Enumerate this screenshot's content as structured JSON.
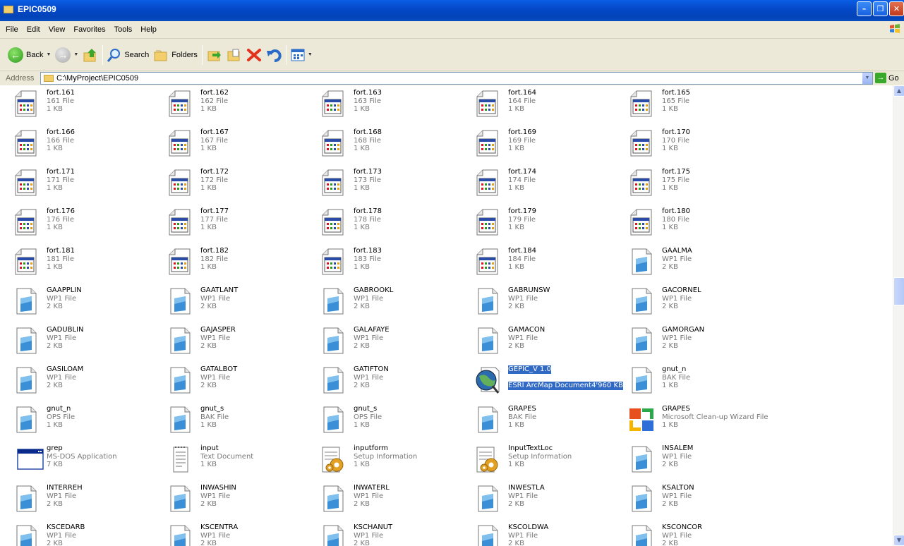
{
  "window": {
    "title": "EPIC0509"
  },
  "menu": [
    "File",
    "Edit",
    "View",
    "Favorites",
    "Tools",
    "Help"
  ],
  "toolbar": {
    "back": "Back",
    "search": "Search",
    "folders": "Folders"
  },
  "address": {
    "label": "Address",
    "path": "C:\\MyProject\\EPIC0509",
    "go": "Go"
  },
  "files": [
    {
      "name": "fort.161",
      "type": "161 File",
      "size": "1 KB",
      "icon": "data-file"
    },
    {
      "name": "fort.162",
      "type": "162 File",
      "size": "1 KB",
      "icon": "data-file"
    },
    {
      "name": "fort.163",
      "type": "163 File",
      "size": "1 KB",
      "icon": "data-file"
    },
    {
      "name": "fort.164",
      "type": "164 File",
      "size": "1 KB",
      "icon": "data-file"
    },
    {
      "name": "fort.165",
      "type": "165 File",
      "size": "1 KB",
      "icon": "data-file"
    },
    {
      "name": "fort.166",
      "type": "166 File",
      "size": "1 KB",
      "icon": "data-file"
    },
    {
      "name": "fort.167",
      "type": "167 File",
      "size": "1 KB",
      "icon": "data-file"
    },
    {
      "name": "fort.168",
      "type": "168 File",
      "size": "1 KB",
      "icon": "data-file"
    },
    {
      "name": "fort.169",
      "type": "169 File",
      "size": "1 KB",
      "icon": "data-file"
    },
    {
      "name": "fort.170",
      "type": "170 File",
      "size": "1 KB",
      "icon": "data-file"
    },
    {
      "name": "fort.171",
      "type": "171 File",
      "size": "1 KB",
      "icon": "data-file"
    },
    {
      "name": "fort.172",
      "type": "172 File",
      "size": "1 KB",
      "icon": "data-file"
    },
    {
      "name": "fort.173",
      "type": "173 File",
      "size": "1 KB",
      "icon": "data-file"
    },
    {
      "name": "fort.174",
      "type": "174 File",
      "size": "1 KB",
      "icon": "data-file"
    },
    {
      "name": "fort.175",
      "type": "175 File",
      "size": "1 KB",
      "icon": "data-file"
    },
    {
      "name": "fort.176",
      "type": "176 File",
      "size": "1 KB",
      "icon": "data-file"
    },
    {
      "name": "fort.177",
      "type": "177 File",
      "size": "1 KB",
      "icon": "data-file"
    },
    {
      "name": "fort.178",
      "type": "178 File",
      "size": "1 KB",
      "icon": "data-file"
    },
    {
      "name": "fort.179",
      "type": "179 File",
      "size": "1 KB",
      "icon": "data-file"
    },
    {
      "name": "fort.180",
      "type": "180 File",
      "size": "1 KB",
      "icon": "data-file"
    },
    {
      "name": "fort.181",
      "type": "181 File",
      "size": "1 KB",
      "icon": "data-file"
    },
    {
      "name": "fort.182",
      "type": "182 File",
      "size": "1 KB",
      "icon": "data-file"
    },
    {
      "name": "fort.183",
      "type": "183 File",
      "size": "1 KB",
      "icon": "data-file"
    },
    {
      "name": "fort.184",
      "type": "184 File",
      "size": "1 KB",
      "icon": "data-file"
    },
    {
      "name": "GAALMA",
      "type": "WP1 File",
      "size": "2 KB",
      "icon": "generic-file"
    },
    {
      "name": "GAAPPLIN",
      "type": "WP1 File",
      "size": "2 KB",
      "icon": "generic-file"
    },
    {
      "name": "GAATLANT",
      "type": "WP1 File",
      "size": "2 KB",
      "icon": "generic-file"
    },
    {
      "name": "GABROOKL",
      "type": "WP1 File",
      "size": "2 KB",
      "icon": "generic-file"
    },
    {
      "name": "GABRUNSW",
      "type": "WP1 File",
      "size": "2 KB",
      "icon": "generic-file"
    },
    {
      "name": "GACORNEL",
      "type": "WP1 File",
      "size": "2 KB",
      "icon": "generic-file"
    },
    {
      "name": "GADUBLIN",
      "type": "WP1 File",
      "size": "2 KB",
      "icon": "generic-file"
    },
    {
      "name": "GAJASPER",
      "type": "WP1 File",
      "size": "2 KB",
      "icon": "generic-file"
    },
    {
      "name": "GALAFAYE",
      "type": "WP1 File",
      "size": "2 KB",
      "icon": "generic-file"
    },
    {
      "name": "GAMACON",
      "type": "WP1 File",
      "size": "2 KB",
      "icon": "generic-file"
    },
    {
      "name": "GAMORGAN",
      "type": "WP1 File",
      "size": "2 KB",
      "icon": "generic-file"
    },
    {
      "name": "GASILOAM",
      "type": "WP1 File",
      "size": "2 KB",
      "icon": "generic-file"
    },
    {
      "name": "GATALBOT",
      "type": "WP1 File",
      "size": "2 KB",
      "icon": "generic-file"
    },
    {
      "name": "GATIFTON",
      "type": "WP1 File",
      "size": "2 KB",
      "icon": "generic-file"
    },
    {
      "name": "GEPIC_V 1.0",
      "type": "ESRI ArcMap Document",
      "size": "4'960 KB",
      "icon": "arcmap-file",
      "selected": true
    },
    {
      "name": "gnut_n",
      "type": "BAK File",
      "size": "1 KB",
      "icon": "generic-file"
    },
    {
      "name": "gnut_n",
      "type": "OPS File",
      "size": "1 KB",
      "icon": "generic-file"
    },
    {
      "name": "gnut_s",
      "type": "BAK File",
      "size": "1 KB",
      "icon": "generic-file"
    },
    {
      "name": "gnut_s",
      "type": "OPS File",
      "size": "1 KB",
      "icon": "generic-file"
    },
    {
      "name": "GRAPES",
      "type": "BAK File",
      "size": "1 KB",
      "icon": "generic-file"
    },
    {
      "name": "GRAPES",
      "type": "Microsoft Clean-up Wizard File",
      "size": "1 KB",
      "icon": "office-file"
    },
    {
      "name": "grep",
      "type": "MS-DOS Application",
      "size": "7 KB",
      "icon": "dos-app"
    },
    {
      "name": "input",
      "type": "Text Document",
      "size": "1 KB",
      "icon": "text-file"
    },
    {
      "name": "inputform",
      "type": "Setup Information",
      "size": "1 KB",
      "icon": "setup-file"
    },
    {
      "name": "InputTextLoc",
      "type": "Setup Information",
      "size": "1 KB",
      "icon": "setup-file"
    },
    {
      "name": "INSALEM",
      "type": "WP1 File",
      "size": "2 KB",
      "icon": "generic-file"
    },
    {
      "name": "INTERREH",
      "type": "WP1 File",
      "size": "2 KB",
      "icon": "generic-file"
    },
    {
      "name": "INWASHIN",
      "type": "WP1 File",
      "size": "2 KB",
      "icon": "generic-file"
    },
    {
      "name": "INWATERL",
      "type": "WP1 File",
      "size": "2 KB",
      "icon": "generic-file"
    },
    {
      "name": "INWESTLA",
      "type": "WP1 File",
      "size": "2 KB",
      "icon": "generic-file"
    },
    {
      "name": "KSALTON",
      "type": "WP1 File",
      "size": "2 KB",
      "icon": "generic-file"
    },
    {
      "name": "KSCEDARB",
      "type": "WP1 File",
      "size": "2 KB",
      "icon": "generic-file"
    },
    {
      "name": "KSCENTRA",
      "type": "WP1 File",
      "size": "2 KB",
      "icon": "generic-file"
    },
    {
      "name": "KSCHANUT",
      "type": "WP1 File",
      "size": "2 KB",
      "icon": "generic-file"
    },
    {
      "name": "KSCOLDWA",
      "type": "WP1 File",
      "size": "2 KB",
      "icon": "generic-file"
    },
    {
      "name": "KSCONCOR",
      "type": "WP1 File",
      "size": "2 KB",
      "icon": "generic-file"
    }
  ],
  "colors": {
    "titlebar": "#0549c9",
    "chrome": "#ece9d8",
    "selection": "#316ac5"
  }
}
